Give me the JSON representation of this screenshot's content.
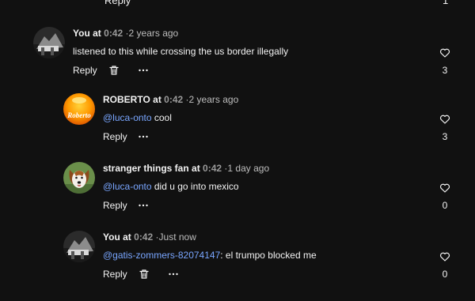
{
  "top": {
    "reply_label": "Reply",
    "like_count": "1"
  },
  "comments": [
    {
      "author": "You",
      "at_word": "at",
      "timestamp": "0:42",
      "separator": "·",
      "when": "2 years ago",
      "text_before": "listened to this while crossing the us border illegally",
      "mention": "",
      "text_after": "",
      "reply_label": "Reply",
      "like_count": "3",
      "avatar_icon": "grayscale-photo-avatar",
      "has_delete": true
    },
    {
      "author": "ROBERTO",
      "at_word": "at",
      "timestamp": "0:42",
      "separator": "·",
      "when": "2 years ago",
      "text_before": "",
      "mention": "@luca-onto",
      "text_after": " cool",
      "reply_label": "Reply",
      "like_count": "3",
      "avatar_icon": "orange-logo-avatar",
      "avatar_text": "Roberto",
      "has_delete": false
    },
    {
      "author": "stranger things fan",
      "at_word": "at",
      "timestamp": "0:42",
      "separator": "·",
      "when": "1 day ago",
      "text_before": "",
      "mention": "@luca-onto",
      "text_after": " did u go into mexico",
      "reply_label": "Reply",
      "like_count": "0",
      "avatar_icon": "dog-photo-avatar",
      "has_delete": false
    },
    {
      "author": "You",
      "at_word": "at",
      "timestamp": "0:42",
      "separator": "·",
      "when": "Just now",
      "text_before": "",
      "mention": "@gatis-zommers-82074147",
      "text_after": ": el trumpo blocked me",
      "reply_label": "Reply",
      "like_count": "0",
      "avatar_icon": "grayscale-photo-avatar",
      "has_delete": true
    }
  ],
  "colors": {
    "background": "#111111",
    "text": "#f2f2f2",
    "muted": "#9a9a9a",
    "mention": "#79a6ff"
  },
  "icons": {
    "like": "heart-outline-icon",
    "delete": "trash-icon",
    "more": "more-horizontal-icon"
  }
}
